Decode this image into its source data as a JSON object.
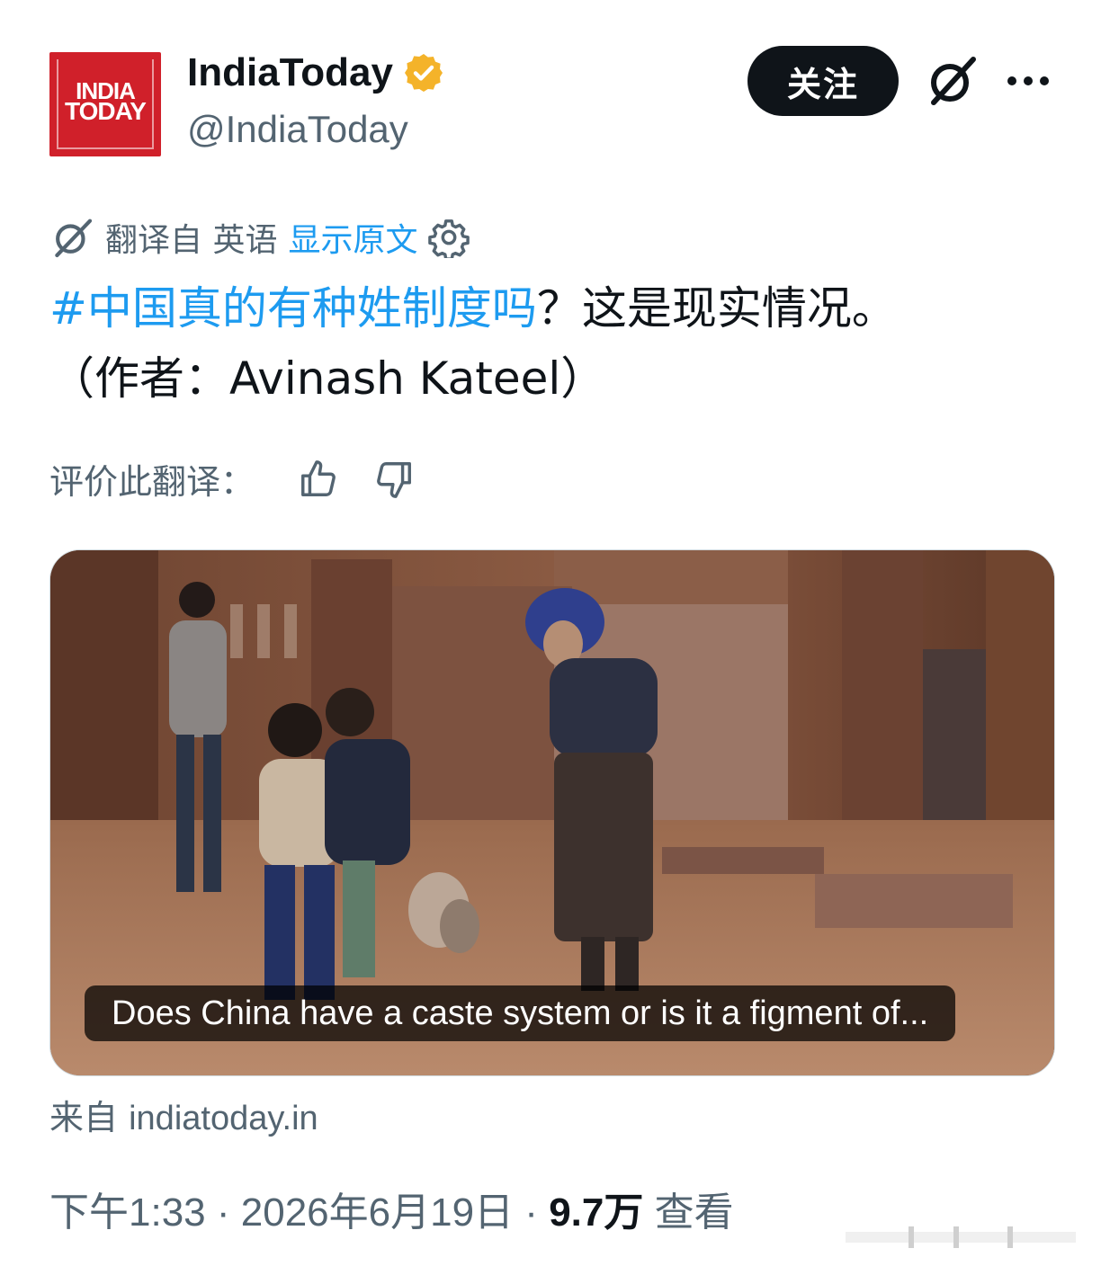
{
  "account": {
    "logo_line1": "INDIA",
    "logo_line2": "TODAY",
    "display_name": "IndiaToday",
    "handle": "@IndiaToday",
    "verified_color": "#f4b32a",
    "verified_icon": "verified-badge-icon"
  },
  "header": {
    "follow_label": "关注",
    "grok_icon": "grok-icon",
    "more_icon": "more-icon"
  },
  "translation": {
    "translated_from": "翻译自 英语",
    "show_original": "显示原文",
    "settings_icon": "gear-icon"
  },
  "tweet": {
    "hashtag": "#中国真的有种姓制度吗",
    "text_after_hashtag": "？这是现实情况。",
    "line2": "（作者：Avinash Kateel）"
  },
  "rating": {
    "label": "评价此翻译：",
    "thumbs_up_icon": "thumbs-up-icon",
    "thumbs_down_icon": "thumbs-down-icon"
  },
  "card": {
    "caption": "Does China have a caste system or is it a figment of..."
  },
  "source": {
    "prefix": "来自",
    "domain": "indiatoday.in"
  },
  "meta": {
    "time": "下午1:33",
    "separator": "·",
    "date": "2026年6月19日",
    "views_count": "9.7万",
    "views_label": "查看"
  },
  "colors": {
    "accent": "#1d9bf0",
    "text": "#0f1419",
    "muted": "#536471",
    "brand_red": "#d0202a"
  }
}
